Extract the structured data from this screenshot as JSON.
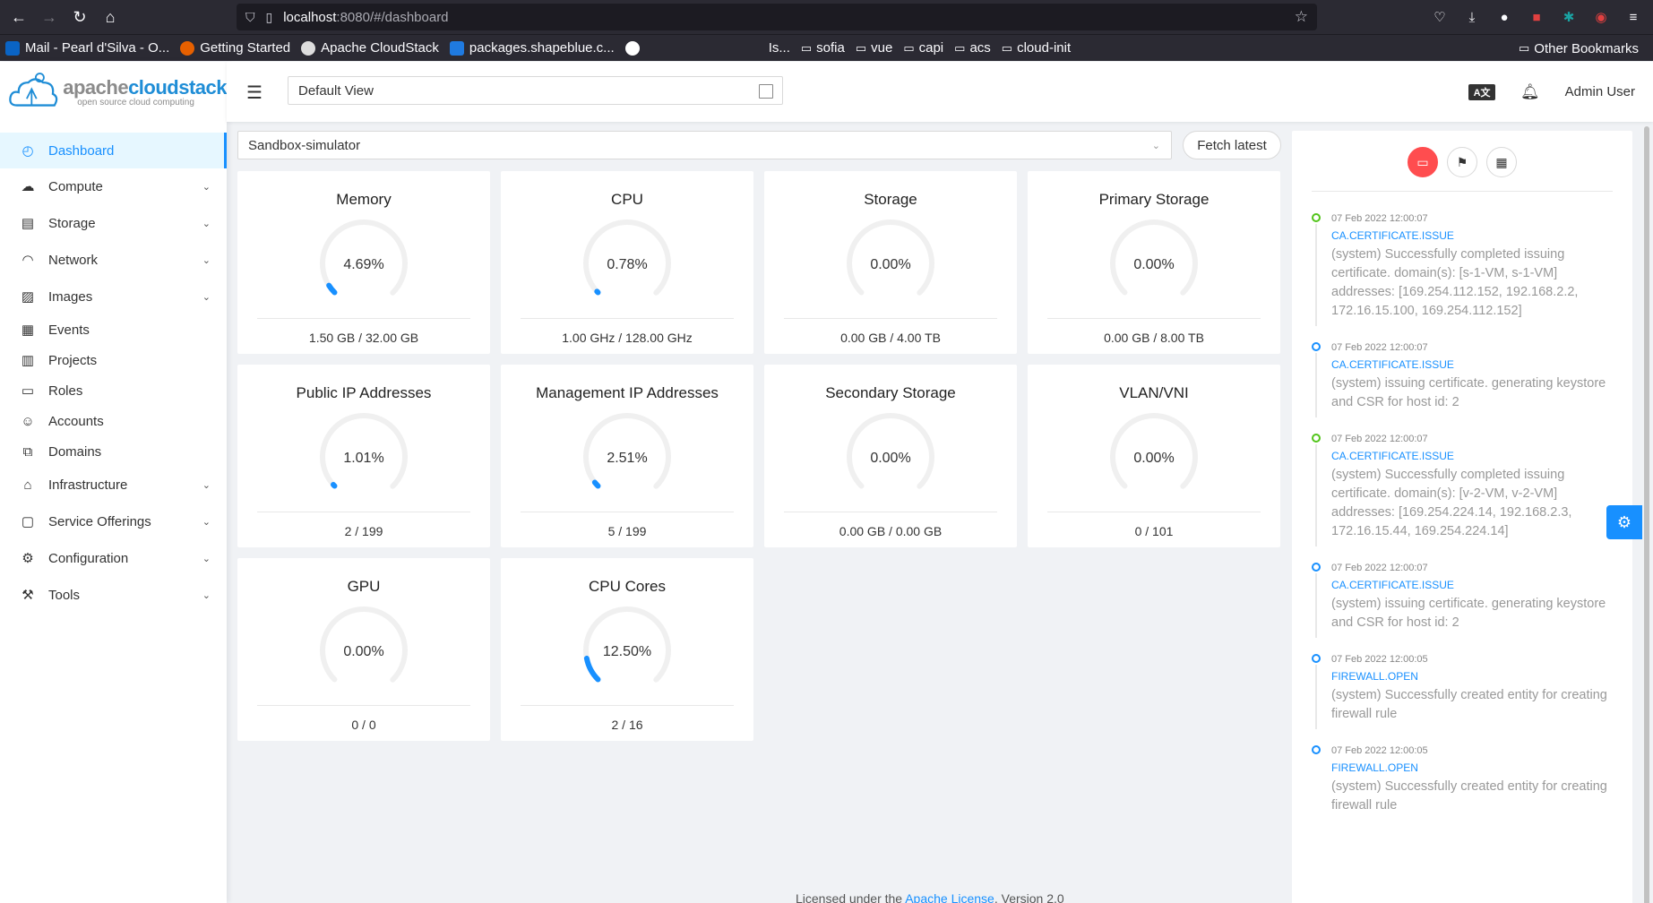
{
  "browser": {
    "url_host": "localhost",
    "url_path": ":8080/#/dashboard",
    "bookmarks": [
      {
        "label": "Mail - Pearl d'Silva - O...",
        "color": "#0a64c5"
      },
      {
        "label": "Getting Started",
        "color": "#e66000"
      },
      {
        "label": "Apache CloudStack",
        "color": "#dddddd"
      },
      {
        "label": "packages.shapeblue.c...",
        "color": "#1f7ae0"
      },
      {
        "label": "",
        "color": "#ffffff"
      }
    ],
    "bookmarks_mid": [
      "Is...",
      "sofia",
      "vue",
      "capi",
      "acs",
      "cloud-init"
    ],
    "other_bookmarks": "Other Bookmarks"
  },
  "logo": {
    "name_prefix": "apache",
    "name_suffix": "cloudstack",
    "tagline": "open source cloud computing"
  },
  "sidebar": {
    "items": [
      {
        "label": "Dashboard",
        "icon": "dashboard-icon",
        "glyph": "◴",
        "active": true,
        "submenu": false
      },
      {
        "label": "Compute",
        "icon": "cloud-icon",
        "glyph": "☁",
        "active": false,
        "submenu": true
      },
      {
        "label": "Storage",
        "icon": "database-icon",
        "glyph": "▤",
        "active": false,
        "submenu": true
      },
      {
        "label": "Network",
        "icon": "wifi-icon",
        "glyph": "◠",
        "active": false,
        "submenu": true
      },
      {
        "label": "Images",
        "icon": "picture-icon",
        "glyph": "▨",
        "active": false,
        "submenu": true
      },
      {
        "label": "Events",
        "icon": "schedule-icon",
        "glyph": "▦",
        "active": false,
        "submenu": false
      },
      {
        "label": "Projects",
        "icon": "project-icon",
        "glyph": "▥",
        "active": false,
        "submenu": false
      },
      {
        "label": "Roles",
        "icon": "idcard-icon",
        "glyph": "▭",
        "active": false,
        "submenu": false
      },
      {
        "label": "Accounts",
        "icon": "team-icon",
        "glyph": "☺",
        "active": false,
        "submenu": false
      },
      {
        "label": "Domains",
        "icon": "block-icon",
        "glyph": "⧉",
        "active": false,
        "submenu": false
      },
      {
        "label": "Infrastructure",
        "icon": "bank-icon",
        "glyph": "⌂",
        "active": false,
        "submenu": true
      },
      {
        "label": "Service Offerings",
        "icon": "shopping-icon",
        "glyph": "▢",
        "active": false,
        "submenu": true
      },
      {
        "label": "Configuration",
        "icon": "setting-icon",
        "glyph": "⚙",
        "active": false,
        "submenu": true
      },
      {
        "label": "Tools",
        "icon": "tool-icon",
        "glyph": "⚒",
        "active": false,
        "submenu": true
      }
    ]
  },
  "header": {
    "project": "Default View",
    "user": "Admin User"
  },
  "dashboard": {
    "zone": "Sandbox-simulator",
    "fetch_label": "Fetch latest",
    "cards": [
      {
        "title": "Memory",
        "percent": 4.69,
        "percent_label": "4.69%",
        "footer": "1.50 GB / 32.00 GB"
      },
      {
        "title": "CPU",
        "percent": 0.78,
        "percent_label": "0.78%",
        "footer": "1.00 GHz / 128.00 GHz"
      },
      {
        "title": "Storage",
        "percent": 0,
        "percent_label": "0.00%",
        "footer": "0.00 GB / 4.00 TB"
      },
      {
        "title": "Primary Storage",
        "percent": 0,
        "percent_label": "0.00%",
        "footer": "0.00 GB / 8.00 TB"
      },
      {
        "title": "Public IP Addresses",
        "percent": 1.01,
        "percent_label": "1.01%",
        "footer": "2 / 199"
      },
      {
        "title": "Management IP Addresses",
        "percent": 2.51,
        "percent_label": "2.51%",
        "footer": "5 / 199"
      },
      {
        "title": "Secondary Storage",
        "percent": 0,
        "percent_label": "0.00%",
        "footer": "0.00 GB / 0.00 GB"
      },
      {
        "title": "VLAN/VNI",
        "percent": 0,
        "percent_label": "0.00%",
        "footer": "0 / 101"
      },
      {
        "title": "GPU",
        "percent": 0,
        "percent_label": "0.00%",
        "footer": "0 / 0"
      },
      {
        "title": "CPU Cores",
        "percent": 12.5,
        "percent_label": "12.50%",
        "footer": "2 / 16"
      }
    ],
    "colors": {
      "progress": "#1890ff",
      "track": "#f0f0f0"
    }
  },
  "events": {
    "items": [
      {
        "time": "07 Feb 2022 12:00:07",
        "type": "CA.CERTIFICATE.ISSUE",
        "desc": "(system) Successfully completed issuing certificate. domain(s): [s-1-VM, s-1-VM] addresses: [169.254.112.152, 192.168.2.2, 172.16.15.100, 169.254.112.152]",
        "status": "green"
      },
      {
        "time": "07 Feb 2022 12:00:07",
        "type": "CA.CERTIFICATE.ISSUE",
        "desc": "(system) issuing certificate. generating keystore and CSR for host id: 2",
        "status": "blue"
      },
      {
        "time": "07 Feb 2022 12:00:07",
        "type": "CA.CERTIFICATE.ISSUE",
        "desc": "(system) Successfully completed issuing certificate. domain(s): [v-2-VM, v-2-VM] addresses: [169.254.224.14, 192.168.2.3, 172.16.15.44, 169.254.224.14]",
        "status": "green"
      },
      {
        "time": "07 Feb 2022 12:00:07",
        "type": "CA.CERTIFICATE.ISSUE",
        "desc": "(system) issuing certificate. generating keystore and CSR for host id: 2",
        "status": "blue"
      },
      {
        "time": "07 Feb 2022 12:00:05",
        "type": "FIREWALL.OPEN",
        "desc": "(system) Successfully created entity for creating firewall rule",
        "status": "blue"
      },
      {
        "time": "07 Feb 2022 12:00:05",
        "type": "FIREWALL.OPEN",
        "desc": "(system) Successfully created entity for creating firewall rule",
        "status": "blue"
      }
    ]
  },
  "footer": {
    "prefix": "Licensed under the",
    "link": "Apache License",
    "suffix": ", Version 2.0"
  }
}
